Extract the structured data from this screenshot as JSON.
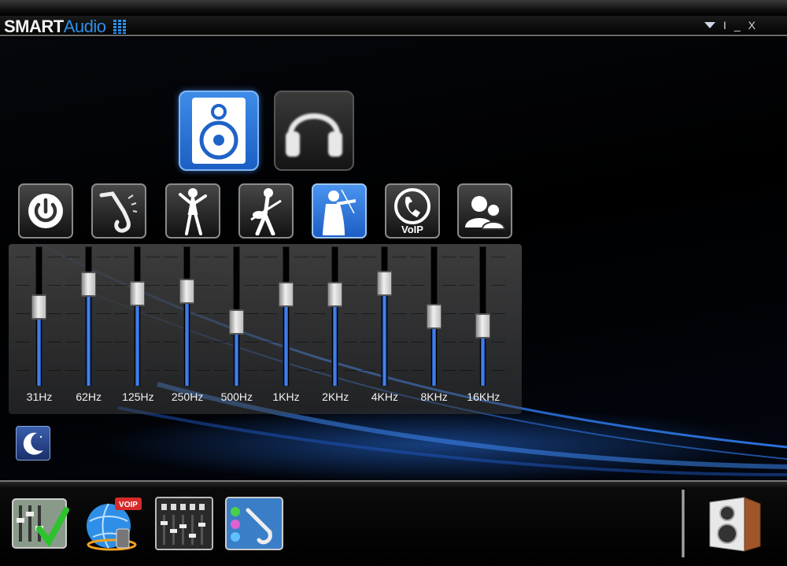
{
  "app": {
    "title_part1": "SMART",
    "title_part2": "Audio"
  },
  "window_controls": {
    "minimize": "_",
    "close": "X",
    "separator": "I"
  },
  "devices": [
    {
      "name": "speaker",
      "icon": "speaker-icon",
      "active": true
    },
    {
      "name": "headphones",
      "icon": "headphones-icon",
      "active": false
    }
  ],
  "presets": [
    {
      "name": "power",
      "icon": "power-icon",
      "active": false
    },
    {
      "name": "jazz",
      "icon": "saxophone-icon",
      "active": false
    },
    {
      "name": "pop",
      "icon": "dancer-icon",
      "active": false
    },
    {
      "name": "rock",
      "icon": "guitarist-icon",
      "active": false
    },
    {
      "name": "classical",
      "icon": "violinist-icon",
      "active": true
    },
    {
      "name": "voip",
      "icon": "voip-phone-icon",
      "label": "VoIP",
      "active": false
    },
    {
      "name": "user",
      "icon": "user-profile-icon",
      "active": false
    }
  ],
  "equalizer": {
    "bands": [
      {
        "label": "31Hz",
        "level": 0.58
      },
      {
        "label": "62Hz",
        "level": 0.78
      },
      {
        "label": "125Hz",
        "level": 0.7
      },
      {
        "label": "250Hz",
        "level": 0.72
      },
      {
        "label": "500Hz",
        "level": 0.45
      },
      {
        "label": "1KHz",
        "level": 0.69
      },
      {
        "label": "2KHz",
        "level": 0.69
      },
      {
        "label": "4KHz",
        "level": 0.79
      },
      {
        "label": "8KHz",
        "level": 0.5
      },
      {
        "label": "16KHz",
        "level": 0.42
      }
    ]
  },
  "night_mode": {
    "icon": "moon-icon"
  },
  "bottom_nav": [
    {
      "name": "settings-check",
      "icon": "mixer-check-icon"
    },
    {
      "name": "voip-globe",
      "icon": "voip-globe-icon",
      "badge": "VOIP"
    },
    {
      "name": "equalizer",
      "icon": "equalizer-panel-icon",
      "active": true
    },
    {
      "name": "audio-jack",
      "icon": "audio-jack-icon"
    },
    {
      "name": "speaker-cabinet",
      "icon": "speaker-cabinet-icon"
    }
  ],
  "colors": {
    "accent": "#2e8fe8",
    "active_button": "#1c5fc4",
    "background": "#000000"
  }
}
